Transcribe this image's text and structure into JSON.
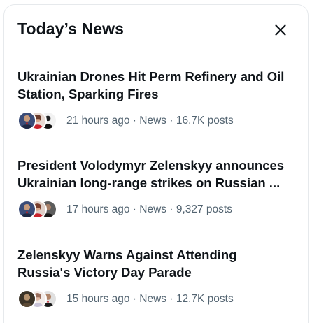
{
  "panel": {
    "title": "Today’s News",
    "close_icon": "close-icon"
  },
  "items": [
    {
      "headline_line1": "Ukrainian Drones Hit Perm Refinery and Oil",
      "headline_line2": "Station, Sparking Fires",
      "time": "21 hours ago",
      "category": "News",
      "posts": "16.7K posts",
      "avatars": [
        "avatar-man-suit",
        "avatar-woman-red",
        "avatar-dark-figure"
      ]
    },
    {
      "headline_line1": "President Volodymyr Zelenskyy announces",
      "headline_line2": "Ukrainian long-range strikes on Russian ...",
      "time": "17 hours ago",
      "category": "News",
      "posts": "9,327 posts",
      "avatars": [
        "avatar-man-suit",
        "avatar-woman-red",
        "avatar-man-dark"
      ]
    },
    {
      "headline_line1": "Zelenskyy Warns Against Attending",
      "headline_line2": "Russia's Victory Day Parade",
      "time": "15 hours ago",
      "category": "News",
      "posts": "12.7K posts",
      "avatars": [
        "avatar-dark-figure",
        "avatar-woman-light",
        "avatar-man-dark"
      ]
    }
  ],
  "separator": " · ",
  "colors": {
    "text_primary": "#0f1419",
    "text_secondary": "#536471",
    "border": "#e6e9ec"
  }
}
